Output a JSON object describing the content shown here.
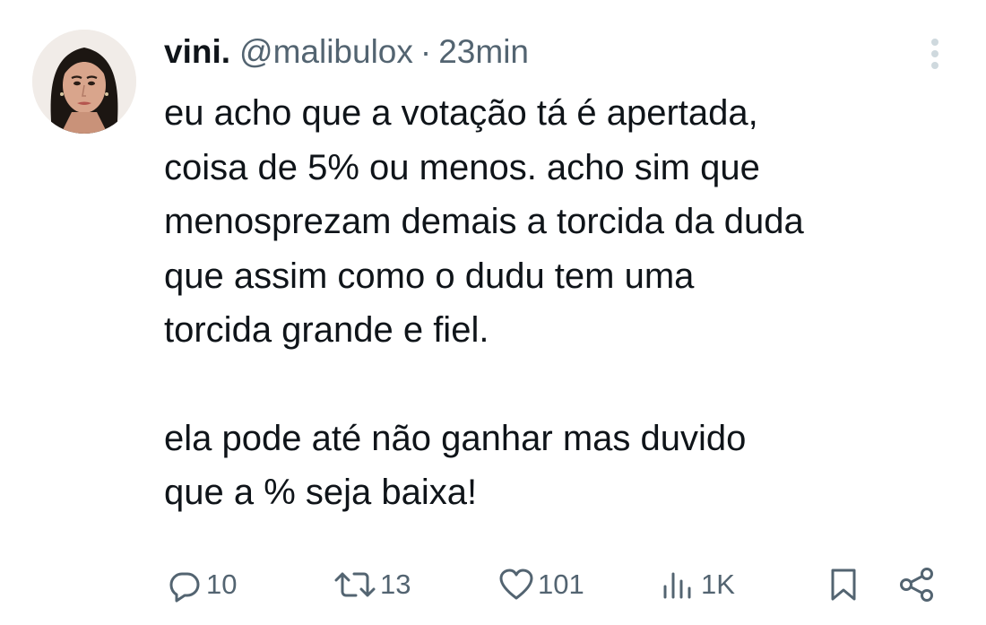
{
  "author": {
    "display_name": "vini.",
    "handle": "@malibulox",
    "separator": "·",
    "time": "23min"
  },
  "body": {
    "paragraphs": [
      [
        "eu acho que a votação tá é apertada,",
        "coisa de 5% ou menos. acho sim que",
        "menosprezam demais a torcida da duda",
        "que assim como o dudu tem uma",
        "torcida grande e fiel."
      ],
      [
        "ela pode até não ganhar mas duvido",
        "que a % seja baixa!"
      ]
    ]
  },
  "actions": {
    "replies": "10",
    "retweets": "13",
    "likes": "101",
    "views": "1K"
  },
  "icons": {
    "more": "more-vertical-icon",
    "reply": "reply-icon",
    "retweet": "retweet-icon",
    "like": "heart-icon",
    "views": "views-icon",
    "bookmark": "bookmark-icon",
    "share": "share-icon"
  },
  "colors": {
    "text": "#0f1419",
    "secondary": "#536471",
    "background": "#ffffff",
    "more_dots": "#cfd9de"
  }
}
